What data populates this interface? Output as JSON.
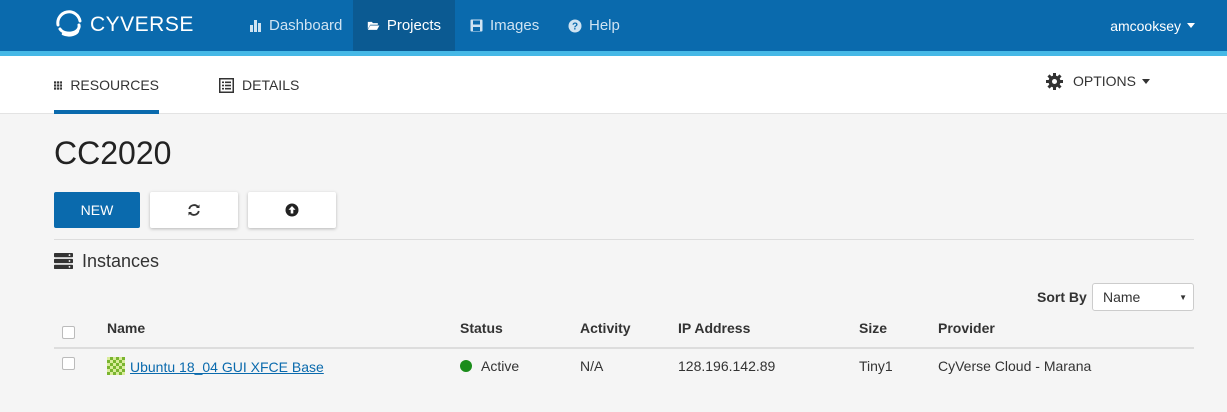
{
  "brand": {
    "name": "CYVERSE"
  },
  "nav": {
    "items": [
      {
        "label": "Dashboard",
        "icon": "bar-chart-icon"
      },
      {
        "label": "Projects",
        "icon": "folder-open-icon"
      },
      {
        "label": "Images",
        "icon": "floppy-disk-icon"
      },
      {
        "label": "Help",
        "icon": "question-circle-icon"
      }
    ],
    "user": "amcooksey"
  },
  "subnav": {
    "tabs": [
      {
        "label": "RESOURCES",
        "icon": "grid-icon"
      },
      {
        "label": "DETAILS",
        "icon": "list-icon"
      }
    ],
    "options_label": "OPTIONS"
  },
  "project": {
    "title": "CC2020",
    "new_label": "NEW"
  },
  "instances": {
    "title": "Instances",
    "sort_by_label": "Sort By",
    "sort_by_value": "Name",
    "columns": [
      "Name",
      "Status",
      "Activity",
      "IP Address",
      "Size",
      "Provider"
    ],
    "rows": [
      {
        "name": "Ubuntu 18_04 GUI XFCE Base",
        "status": "Active",
        "activity": "N/A",
        "ip": "128.196.142.89",
        "size": "Tiny1",
        "provider": "CyVerse Cloud - Marana"
      }
    ]
  },
  "colors": {
    "navbar": "#0a6aad",
    "navbar_stripe": "#45b8e6",
    "active_status": "#1a8c1a"
  }
}
